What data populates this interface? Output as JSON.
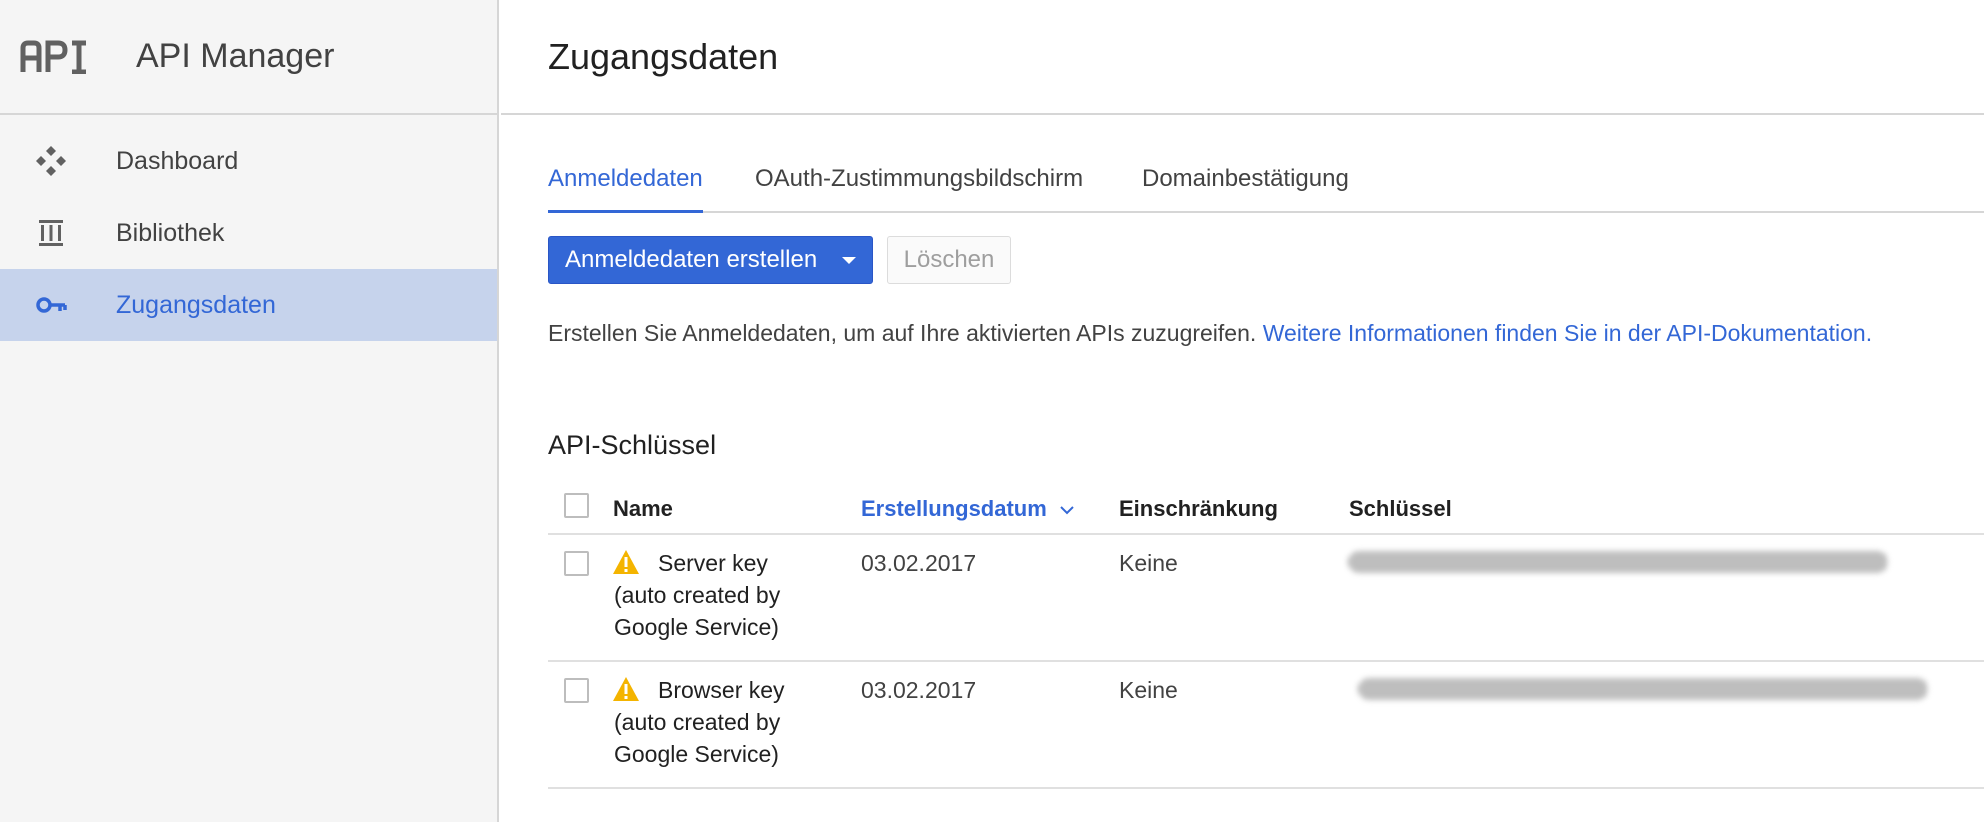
{
  "sidebar": {
    "logo_icon": "api-logo-icon",
    "app_title": "API Manager",
    "items": [
      {
        "label": "Dashboard",
        "icon": "dashboard-icon",
        "active": false
      },
      {
        "label": "Bibliothek",
        "icon": "library-icon",
        "active": false
      },
      {
        "label": "Zugangsdaten",
        "icon": "key-icon",
        "active": true
      }
    ]
  },
  "header": {
    "title": "Zugangsdaten"
  },
  "tabs": [
    {
      "label": "Anmeldedaten",
      "active": true
    },
    {
      "label": "OAuth-Zustimmungsbildschirm",
      "active": false
    },
    {
      "label": "Domainbestätigung",
      "active": false
    }
  ],
  "toolbar": {
    "create_label": "Anmeldedaten erstellen",
    "delete_label": "Löschen"
  },
  "info": {
    "text": "Erstellen Sie Anmeldedaten, um auf Ihre aktivierten APIs zuzugreifen.",
    "link": "Weitere Informationen finden Sie in der API-Dokumentation."
  },
  "api_keys": {
    "title": "API-Schlüssel",
    "columns": [
      "Name",
      "Erstellungsdatum",
      "Einschränkung",
      "Schlüssel"
    ],
    "sorted_column": "Erstellungsdatum",
    "rows": [
      {
        "name": "Server key (auto created by Google Service)",
        "date": "03.02.2017",
        "restriction": "Keine",
        "key": "",
        "warning_icon": "warning-icon"
      },
      {
        "name": "Browser key (auto created by Google Service)",
        "date": "03.02.2017",
        "restriction": "Keine",
        "key": "",
        "warning_icon": "warning-icon"
      }
    ]
  },
  "colors": {
    "accent": "#3367d6",
    "active_nav_bg": "#c6d3ec",
    "warning": "#f4b400"
  }
}
